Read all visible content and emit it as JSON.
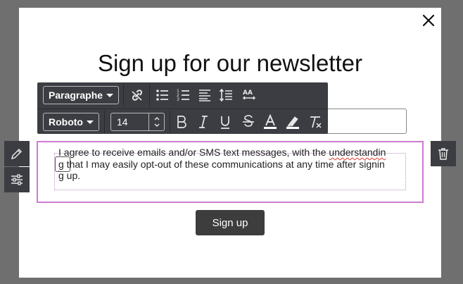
{
  "modal": {
    "title": "Sign up for our newsletter",
    "consent_text_plain": "I agree to receive emails and/or SMS text messages, with the ",
    "consent_text_spell": "understandin",
    "consent_text_spell2": "g",
    "consent_text_rest": " that I may easily opt-out of these communications at any time after signing up.",
    "signup_label": "Sign up",
    "checkbox_checked": false
  },
  "toolbar": {
    "block_style": "Paragraphe",
    "font_family": "Roboto",
    "font_size": "14"
  },
  "icons": {
    "close": "close-icon",
    "link": "link-icon",
    "bullet_list": "bullet-list-icon",
    "numbered_list": "numbered-list-icon",
    "align": "align-left-icon",
    "line_height": "line-height-icon",
    "letter_spacing": "letter-spacing-icon",
    "bold": "bold-icon",
    "italic": "italic-icon",
    "underline": "underline-icon",
    "strikethrough": "strikethrough-icon",
    "text_color": "text-color-icon",
    "highlight": "highlight-icon",
    "clear_format": "clear-format-icon",
    "edit": "pencil-icon",
    "settings": "sliders-icon",
    "delete": "trash-icon"
  },
  "colors": {
    "toolbar_bg": "#3b3d42",
    "selection_border": "#cf7ad1",
    "button_bg": "#3d3d3d",
    "overlay": "#6f6f6f",
    "spellcheck": "#e0362c"
  }
}
